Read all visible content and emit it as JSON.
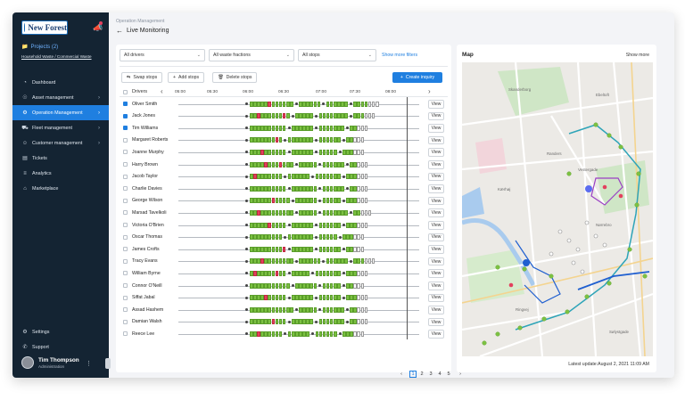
{
  "sidebar": {
    "logo_text": "New Forest",
    "projects_label": "Projects (2)",
    "project_subtitle": "Household Waste / Commercial Waste",
    "items": [
      {
        "label": "Dashboard",
        "icon": "dashboard-icon",
        "chevron": false,
        "active": false
      },
      {
        "label": "Asset management",
        "icon": "asset-icon",
        "chevron": true,
        "active": false
      },
      {
        "label": "Operation Management",
        "icon": "operation-icon",
        "chevron": true,
        "active": true
      },
      {
        "label": "Fleet management",
        "icon": "fleet-icon",
        "chevron": true,
        "active": false
      },
      {
        "label": "Customer management",
        "icon": "customer-icon",
        "chevron": true,
        "active": false
      },
      {
        "label": "Tickets",
        "icon": "tickets-icon",
        "chevron": false,
        "active": false
      },
      {
        "label": "Analytics",
        "icon": "analytics-icon",
        "chevron": false,
        "active": false
      },
      {
        "label": "Marketplace",
        "icon": "marketplace-icon",
        "chevron": false,
        "active": false
      }
    ],
    "bottom_items": [
      {
        "label": "Settings",
        "icon": "settings-icon"
      },
      {
        "label": "Support",
        "icon": "support-icon"
      }
    ],
    "user": {
      "name": "Tim Thompson",
      "role": "Administration"
    }
  },
  "header": {
    "breadcrumb": "Operation Management",
    "title": "Live Monitoring"
  },
  "filters": {
    "drivers": "All drivers",
    "waste": "All waste fractions",
    "stops": "All stops",
    "more": "Show more filters"
  },
  "actions": {
    "swap": "Swap stops",
    "add": "Add stops",
    "delete": "Delete stops",
    "create": "Create inquiry"
  },
  "timeline": {
    "column_label": "Drivers",
    "ticks": [
      "05:00",
      "05:30",
      "06:00",
      "06:30",
      "07:00",
      "07:30",
      "08:00"
    ],
    "view_label": "View"
  },
  "drivers": [
    {
      "name": "Oliver Smith",
      "checked": true
    },
    {
      "name": "Jack Jones",
      "checked": true
    },
    {
      "name": "Tim Williams",
      "checked": true
    },
    {
      "name": "Margaret Roberts",
      "checked": false
    },
    {
      "name": "Joanne Murphy",
      "checked": false
    },
    {
      "name": "Harry Brown",
      "checked": false
    },
    {
      "name": "Jacob Taylor",
      "checked": false
    },
    {
      "name": "Charlie Davies",
      "checked": false
    },
    {
      "name": "George Wilson",
      "checked": false
    },
    {
      "name": "Marsad Tavelkoli",
      "checked": false
    },
    {
      "name": "Victoria O'Brien",
      "checked": false
    },
    {
      "name": "Oscar Thomas",
      "checked": false
    },
    {
      "name": "James Crofts",
      "checked": false
    },
    {
      "name": "Tracy Evans",
      "checked": false
    },
    {
      "name": "William Byrne",
      "checked": false
    },
    {
      "name": "Connor O'Neill",
      "checked": false
    },
    {
      "name": "Siffat Jabal",
      "checked": false
    },
    {
      "name": "Assad Hashem",
      "checked": false
    },
    {
      "name": "Damian Walsh",
      "checked": false
    },
    {
      "name": "Reece Lee",
      "checked": false
    }
  ],
  "pagination": {
    "prev": "‹",
    "pages": [
      "1",
      "2",
      "3",
      "4",
      "5"
    ],
    "current": "1",
    "next": "›"
  },
  "map": {
    "title": "Map",
    "show_more": "Show more",
    "last_update": "Latest update:August 2, 2021 11:09 AM",
    "place_labels": [
      "Skanderborg",
      "Ebeltoft",
      "Randers",
      "Vestergade",
      "Kærhøj",
      "Nørrebro",
      "Ringvej",
      "Sølystgade"
    ]
  },
  "colors": {
    "sidebar_bg": "#142433",
    "accent": "#1f7fe0",
    "stop_done": "#7cc142",
    "stop_issue": "#e3405e"
  }
}
